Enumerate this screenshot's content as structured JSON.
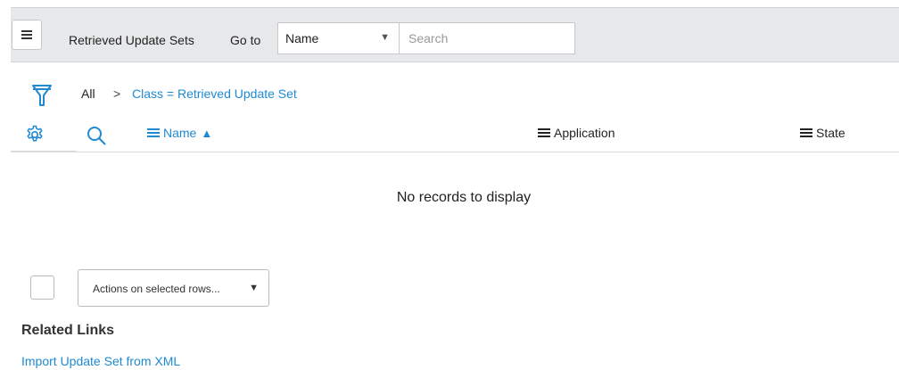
{
  "header": {
    "title": "Retrieved Update Sets",
    "goto_label": "Go to",
    "field_select": {
      "selected": "Name"
    },
    "search": {
      "placeholder": "Search"
    }
  },
  "breadcrumb": {
    "all": "All",
    "separator": ">",
    "condition": "Class = Retrieved Update Set"
  },
  "columns": [
    {
      "label": "Name",
      "sorted": "ascending"
    },
    {
      "label": "Application"
    },
    {
      "label": "State"
    }
  ],
  "list": {
    "empty_message": "No records to display"
  },
  "footer": {
    "actions_select": "Actions on selected rows..."
  },
  "related_links": {
    "heading": "Related Links",
    "items": [
      {
        "label": "Import Update Set from XML"
      }
    ]
  },
  "colors": {
    "link_blue": "#1f8ad1",
    "header_bg": "#e6e8ea",
    "border": "#c5c9ce"
  }
}
